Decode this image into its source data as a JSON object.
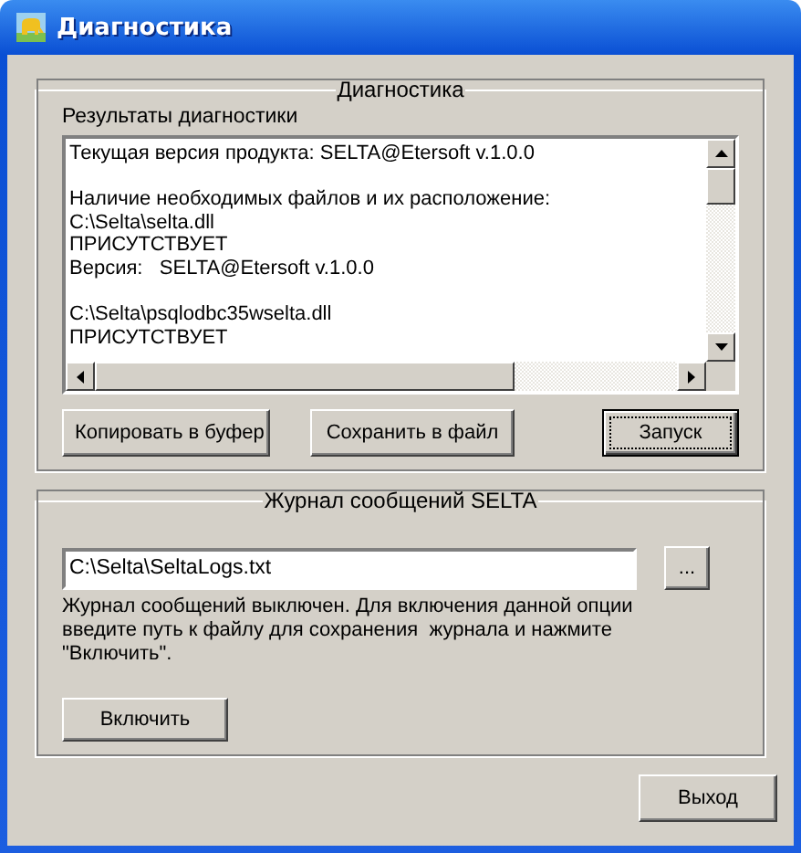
{
  "window": {
    "title": "Диагностика"
  },
  "diagnostics": {
    "legend": "Диагностика",
    "label": "Результаты диагностики",
    "log_blocks": [
      [
        "Текущая версия продукта: SELTA@Etersoft v.1.0.0"
      ],
      [
        "Наличие необходимых файлов и их расположение:",
        "C:\\Selta\\selta.dll",
        "ПРИСУТСТВУЕТ",
        "Версия:   SELTA@Etersoft v.1.0.0"
      ],
      [
        "C:\\Selta\\psqlodbc35wselta.dll",
        "ПРИСУТСТВУЕТ"
      ]
    ],
    "buttons": [
      {
        "label": "Копировать в буфер",
        "default": false
      },
      {
        "label": "Сохранить в файл",
        "default": false
      },
      {
        "label": "Запуск",
        "default": true
      }
    ]
  },
  "log": {
    "legend": "Журнал сообщений SELTA",
    "path": "C:\\Selta\\SeltaLogs.txt",
    "browse": "...",
    "note": "Журнал сообщений выключен. Для включения данной опции введите путь к файлу для сохранения  журнала и нажмите \"Включить\".",
    "button": "Включить"
  },
  "exit_button": "Выход"
}
